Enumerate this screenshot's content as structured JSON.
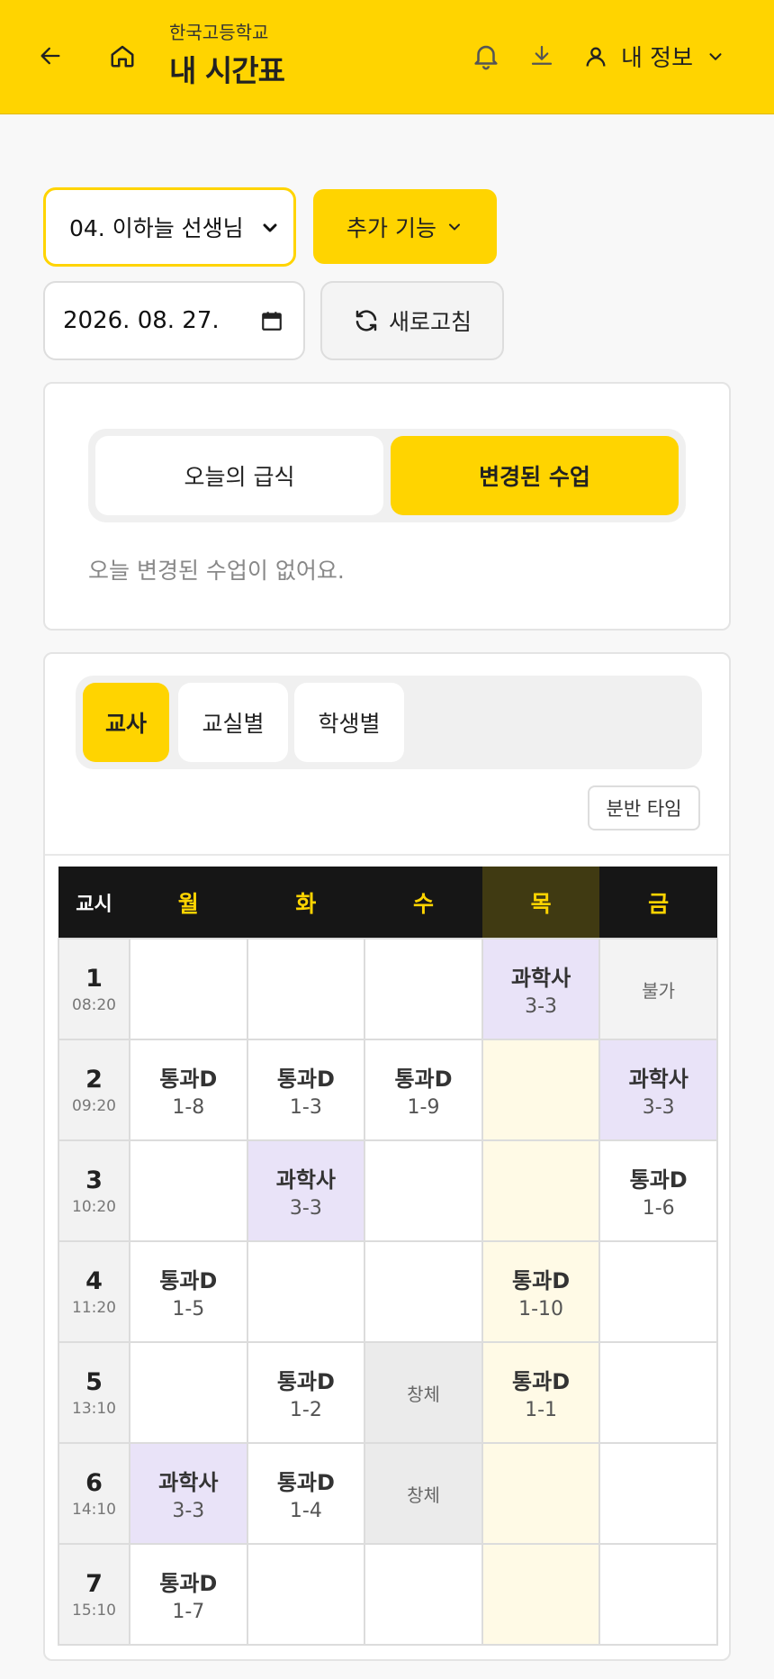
{
  "header": {
    "school": "한국고등학교",
    "title": "내 시간표",
    "user_label": "내 정보",
    "icons": [
      "back-arrow-icon",
      "home-icon",
      "bell-icon",
      "download-icon",
      "user-icon",
      "chevron-down-icon"
    ]
  },
  "controls": {
    "teacher_select": "04. 이하늘 선생님",
    "more_button": "추가 기능",
    "date": "2026. 08. 27.",
    "refresh_button": "새로고침"
  },
  "info_card": {
    "tabs": [
      "오늘의 급식",
      "변경된 수업"
    ],
    "active_tab": "변경된 수업",
    "message": "오늘 변경된 수업이 없어요."
  },
  "timetable_card": {
    "view_tabs": [
      "교사",
      "교실별",
      "학생별"
    ],
    "active_view": "교사",
    "split_button": "분반 타임",
    "header_first": "교시",
    "days": [
      "월",
      "화",
      "수",
      "목",
      "금"
    ],
    "today": "목",
    "rows": [
      {
        "period": "1",
        "time": "08:20",
        "cells": [
          null,
          null,
          null,
          {
            "t": "과학사",
            "r": "3-3",
            "k": "sci"
          },
          {
            "note": "불가",
            "k": "blocked"
          }
        ]
      },
      {
        "period": "2",
        "time": "09:20",
        "cells": [
          {
            "t": "통과D",
            "r": "1-8"
          },
          {
            "t": "통과D",
            "r": "1-3"
          },
          {
            "t": "통과D",
            "r": "1-9"
          },
          null,
          {
            "t": "과학사",
            "r": "3-3",
            "k": "sci"
          }
        ]
      },
      {
        "period": "3",
        "time": "10:20",
        "cells": [
          null,
          {
            "t": "과학사",
            "r": "3-3",
            "k": "sci"
          },
          null,
          null,
          {
            "t": "통과D",
            "r": "1-6"
          }
        ]
      },
      {
        "period": "4",
        "time": "11:20",
        "cells": [
          {
            "t": "통과D",
            "r": "1-5"
          },
          null,
          null,
          {
            "t": "통과D",
            "r": "1-10"
          },
          null
        ]
      },
      {
        "period": "5",
        "time": "13:10",
        "cells": [
          null,
          {
            "t": "통과D",
            "r": "1-2"
          },
          {
            "note": "창체",
            "k": "swap"
          },
          {
            "t": "통과D",
            "r": "1-1"
          },
          null
        ]
      },
      {
        "period": "6",
        "time": "14:10",
        "cells": [
          {
            "t": "과학사",
            "r": "3-3",
            "k": "sci"
          },
          {
            "t": "통과D",
            "r": "1-4"
          },
          {
            "note": "창체",
            "k": "swap"
          },
          null,
          null
        ]
      },
      {
        "period": "7",
        "time": "15:10",
        "cells": [
          {
            "t": "통과D",
            "r": "1-7"
          },
          null,
          null,
          null,
          null
        ]
      }
    ]
  },
  "colors": {
    "accent": "#FFD400",
    "science": "#e9e3f8",
    "today_column": "#fffae6",
    "header_dark": "#161616"
  }
}
